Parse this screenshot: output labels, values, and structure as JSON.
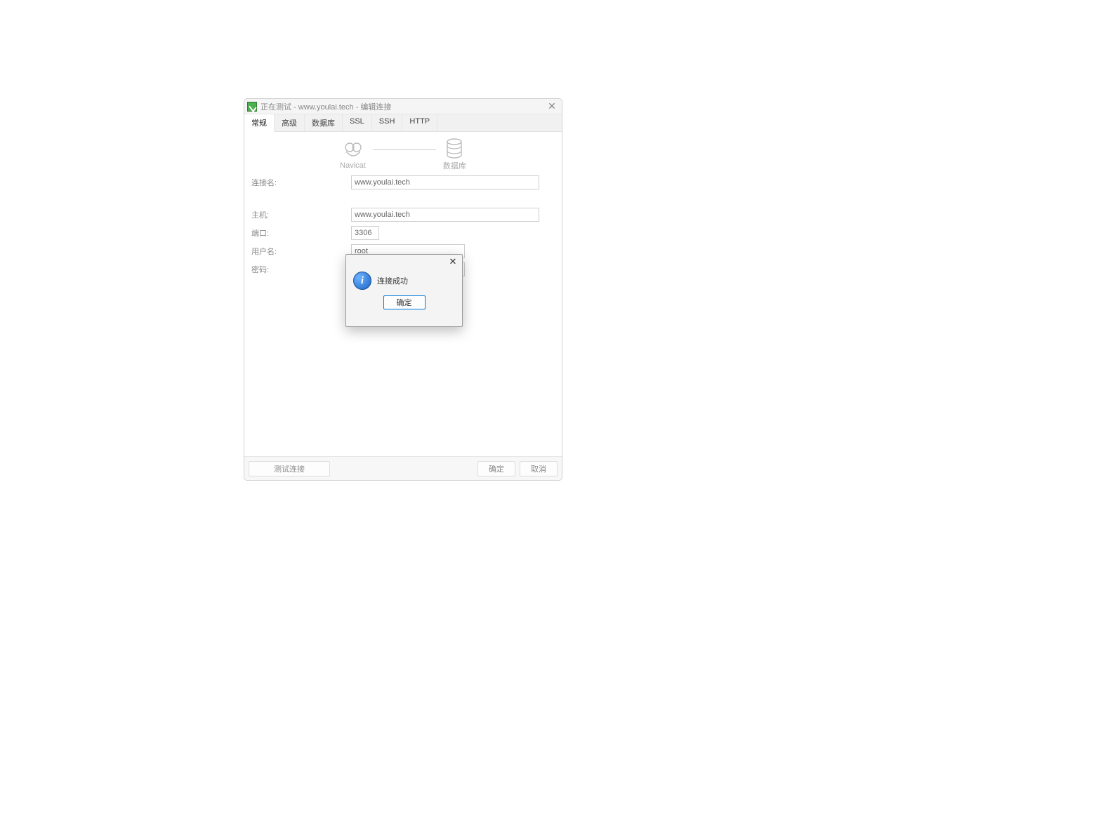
{
  "titlebar": {
    "title": "正在测试 - www.youlai.tech - 编辑连接"
  },
  "tabs": {
    "items": [
      "常规",
      "高级",
      "数据库",
      "SSL",
      "SSH",
      "HTTP"
    ],
    "active_index": 0
  },
  "diagram": {
    "left_label": "Navicat",
    "right_label": "数据库"
  },
  "form": {
    "connection_name_label": "连接名:",
    "connection_name_value": "www.youlai.tech",
    "host_label": "主机:",
    "host_value": "www.youlai.tech",
    "port_label": "端口:",
    "port_value": "3306",
    "user_label": "用户名:",
    "user_value": "root",
    "password_label": "密码:",
    "password_value": ""
  },
  "footer": {
    "test_label": "测试连接",
    "ok_label": "确定",
    "cancel_label": "取消"
  },
  "modal": {
    "message": "连接成功",
    "ok_label": "确定"
  }
}
